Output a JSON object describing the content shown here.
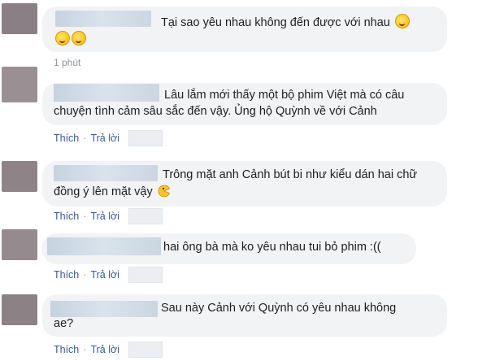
{
  "comments": [
    {
      "line1": "Tại sao yêu nhau không đến được với nhau",
      "line2": "",
      "time": "1 phút",
      "emoji": "laughing-tears-icon"
    },
    {
      "line1": "Lâu lắm mới thấy một bộ phim Việt mà có câu",
      "line2": "chuyện tình cảm sâu sắc đến vậy. Ủng hộ Quỳnh về với Cảnh",
      "like": "Thích",
      "sep": "·",
      "reply": "Trả lời"
    },
    {
      "line1": "Trông mặt anh Cảnh bút bi như kiểu dán hai chữ",
      "line2": "đồng ý lên mặt vậy",
      "like": "Thích",
      "sep": "·",
      "reply": "Trả lời",
      "emoji": "pacman-face-icon"
    },
    {
      "line1": "hai ông bà mà ko yêu nhau tui bỏ phim :((",
      "like": "Thích",
      "sep": "·",
      "reply": "Trả lời"
    },
    {
      "line1": "Sau này Cảnh với Quỳnh có yêu nhau không",
      "line2": "ae?",
      "like": "Thích",
      "sep": "·",
      "reply": "Trả lời"
    }
  ]
}
